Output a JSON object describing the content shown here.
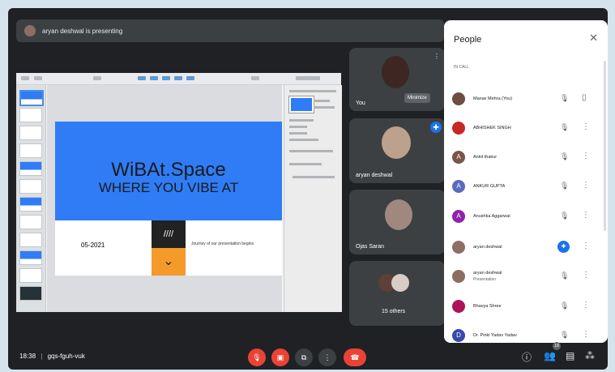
{
  "banner": {
    "text": "aryan deshwal is presenting"
  },
  "slide": {
    "title": "WiBAt.Space",
    "subtitle": "WHERE YOU VIBE AT",
    "date": "05-2021",
    "block_text": "////",
    "arrow": "⌄",
    "journey": "Journey of our presentation begins"
  },
  "tiles": [
    {
      "name": "You",
      "action": "Minimize"
    },
    {
      "name": "aryan deshwal"
    },
    {
      "name": "Ojas Saran"
    },
    {
      "name": "15 others"
    }
  ],
  "panel": {
    "title": "People",
    "close": "✕",
    "section": "IN CALL"
  },
  "people": [
    {
      "name": "Manav Mehra (You)",
      "initial": "",
      "color": "#6d4c41"
    },
    {
      "name": "ABHISHEK SINGH",
      "initial": "",
      "color": "#c62828"
    },
    {
      "name": "Ankit thakur",
      "initial": "A",
      "color": "#795548"
    },
    {
      "name": "ANKUR GUPTA",
      "initial": "A",
      "color": "#5c6bc0"
    },
    {
      "name": "Anushka Aggarwal",
      "initial": "A",
      "color": "#8e24aa"
    },
    {
      "name": "aryan deshwal",
      "initial": "",
      "color": "#8d6e63"
    },
    {
      "name": "aryan deshwal",
      "sub": "Presentation",
      "initial": "",
      "color": "#8d6e63"
    },
    {
      "name": "Bhavya Shree",
      "initial": "",
      "color": "#ad1457"
    },
    {
      "name": "Dr. Pinki Yadav Yadav",
      "initial": "D",
      "color": "#3949ab"
    }
  ],
  "bottom": {
    "time": "18:38",
    "code": "gqs-fguh-vuk",
    "people_count": "18"
  },
  "colors": {
    "end_call": "#ea4335",
    "muted": "#ea4335",
    "control": "#3c4043",
    "accent": "#1a73e8"
  }
}
